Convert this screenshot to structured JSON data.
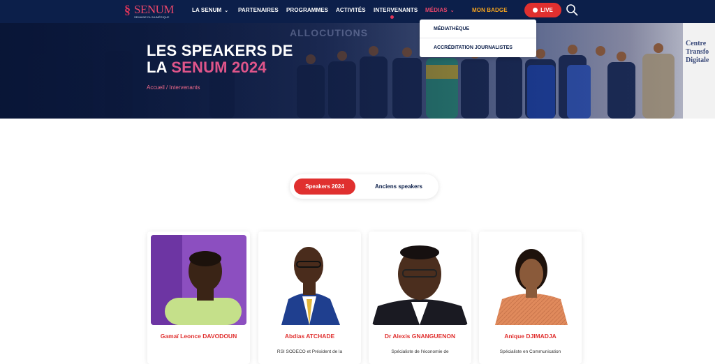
{
  "nav": {
    "logo_text": "SENUM",
    "logo_sub": "SEMAINE DU NUMÉRIQUE",
    "items": [
      {
        "label": "LA SENUM",
        "chevron": true
      },
      {
        "label": "PARTENAIRES"
      },
      {
        "label": "PROGRAMMES"
      },
      {
        "label": "ACTIVITÉS"
      },
      {
        "label": "INTERVENANTS",
        "active": true
      },
      {
        "label": "MÉDIAS",
        "chevron": true
      },
      {
        "label": "MON BADGE"
      }
    ],
    "live_label": "LIVE"
  },
  "dropdown": {
    "items": [
      "MÉDIATHÈQUE",
      "ACCRÉDITATION JOURNALISTES"
    ]
  },
  "hero": {
    "title_line1": "LES SPEAKERS DE",
    "title_line2_prefix": "LA ",
    "title_line2_accent": "SENUM 2024",
    "breadcrumb": "Accueil / Intervenants",
    "banner_text": "ALLOCUTIONS",
    "side_panel_text": [
      "Centre",
      "Transfo",
      "Digitale"
    ]
  },
  "tabs": {
    "active": "Speakers 2024",
    "inactive": "Anciens speakers"
  },
  "speakers": [
    {
      "name": "Gamaï Leonce DAVODOUN",
      "role": ""
    },
    {
      "name": "Abdias ATCHADE",
      "role": "RSI SODECO et Président de la"
    },
    {
      "name": "Dr Alexis GNANGUENON",
      "role": "Spécialiste de l'économie de"
    },
    {
      "name": "Anique DJIMADJA",
      "role": "Spécialiste en Communication"
    }
  ],
  "colors": {
    "nav_bg": "#0c1f4a",
    "accent_red": "#e0302f",
    "accent_pink": "#e0558a",
    "badge_orange": "#f4a41f"
  }
}
